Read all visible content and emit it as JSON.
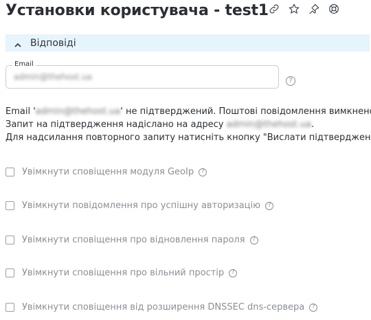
{
  "header": {
    "title": "Установки користувача - test1",
    "icons": [
      "link-icon",
      "star-icon",
      "pin-icon",
      "help-lifebuoy-icon"
    ]
  },
  "section": {
    "label": "Відповіді",
    "expanded": true
  },
  "email_field": {
    "legend": "Email",
    "value": "admin@thehost.ua",
    "help": "?"
  },
  "notice": {
    "line1_prefix": "Email '",
    "line1_email": "admin@thehost.ua",
    "line1_suffix": "' не підтверджений. Поштові повідомлення вимкнено.",
    "line2_prefix": "Запит на підтвердження надіслано на адресу ",
    "line2_email": "admin@thehost.ua",
    "line2_suffix": ".",
    "line3": "Для надсилання повторного запиту натисніть кнопку \"Вислати підтвердження\""
  },
  "options": [
    {
      "label": "Увімкнути сповіщення модуля GeoIp",
      "checked": false,
      "help": "?"
    },
    {
      "label": "Увімкнути повідомлення про успішну авторизацію",
      "checked": false,
      "help": "?"
    },
    {
      "label": "Увімкнути сповіщення про відновлення пароля",
      "checked": false,
      "help": "?"
    },
    {
      "label": "Увімкнути сповіщення про вільний простір",
      "checked": false,
      "help": "?"
    },
    {
      "label": "Увімкнути сповіщення від розширення DNSSEC dns-сервера",
      "checked": false,
      "help": "?"
    }
  ],
  "colors": {
    "section_bg": "#e6f4fc",
    "text": "#2b2e33",
    "muted": "#8a8f95"
  }
}
